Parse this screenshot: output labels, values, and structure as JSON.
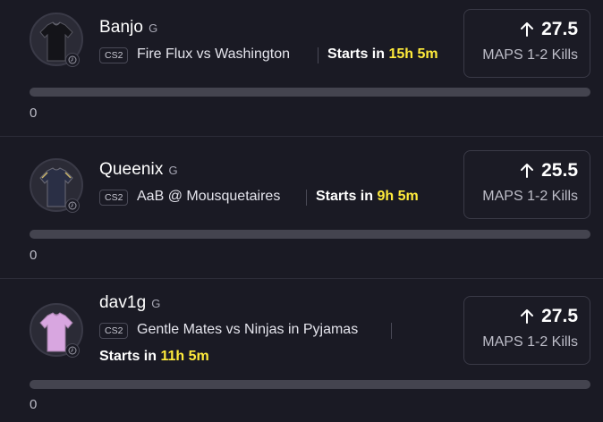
{
  "cards": [
    {
      "player": "Banjo",
      "position": "G",
      "game": "CS2",
      "match": "Fire Flux vs Washington",
      "starts_prefix": "Starts in",
      "starts_time": "15h 5m",
      "direction_icon": "arrow-up-icon",
      "line": "27.5",
      "stat": "MAPS 1-2 Kills",
      "progress_fraction": 0,
      "count": "0",
      "jersey_color": "#1d1d24"
    },
    {
      "player": "Queenix",
      "position": "G",
      "game": "CS2",
      "match": "AaB @ Mousquetaires",
      "starts_prefix": "Starts in",
      "starts_time": "9h 5m",
      "direction_icon": "arrow-up-icon",
      "line": "25.5",
      "stat": "MAPS 1-2 Kills",
      "progress_fraction": 0,
      "count": "0",
      "jersey_color": "#2a2f45"
    },
    {
      "player": "dav1g",
      "position": "G",
      "game": "CS2",
      "match": "Gentle Mates vs Ninjas in Pyjamas",
      "starts_prefix": "Starts in",
      "starts_time": "11h 5m",
      "direction_icon": "arrow-up-icon",
      "line": "27.5",
      "stat": "MAPS 1-2 Kills",
      "progress_fraction": 0,
      "count": "0",
      "jersey_color": "#d8a6e0"
    }
  ],
  "colors": {
    "background": "#1a1a24",
    "accent_time": "#ffeb3b",
    "progress_track": "#44444f"
  }
}
